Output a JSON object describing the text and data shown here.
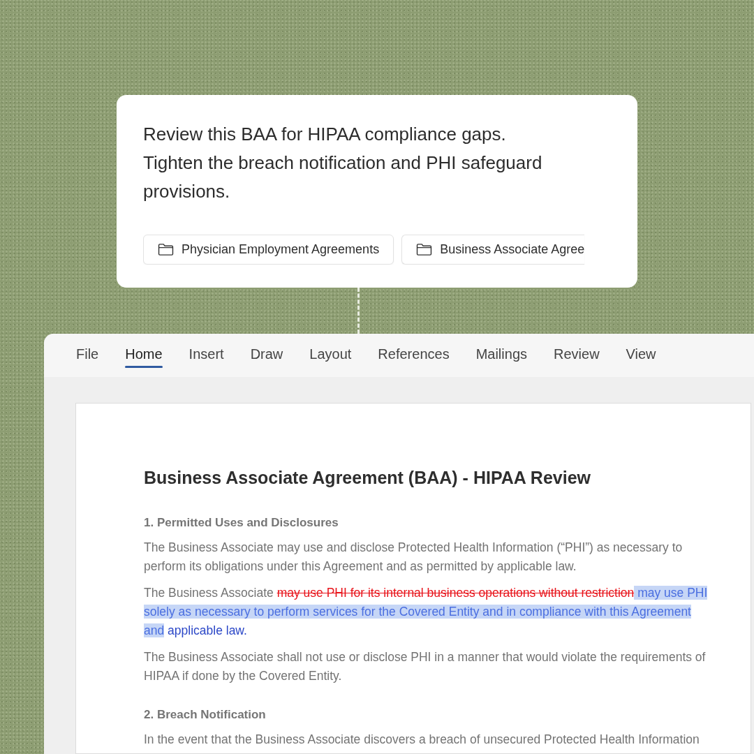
{
  "prompt": {
    "text": "Review this BAA for HIPAA compliance gaps. Tighten the breach notification and PHI safeguard provisions.",
    "folders": [
      {
        "label": "Physician Employment Agreements",
        "cut": false
      },
      {
        "label": "Business Associate Agree",
        "cut": true
      }
    ]
  },
  "ribbon": {
    "tabs": [
      {
        "label": "File",
        "selected": false
      },
      {
        "label": "Home",
        "selected": true
      },
      {
        "label": "Insert",
        "selected": false
      },
      {
        "label": "Draw",
        "selected": false
      },
      {
        "label": "Layout",
        "selected": false
      },
      {
        "label": "References",
        "selected": false
      },
      {
        "label": "Mailings",
        "selected": false
      },
      {
        "label": "Review",
        "selected": false
      },
      {
        "label": "View",
        "selected": false
      }
    ]
  },
  "document": {
    "title": "Business Associate Agreement (BAA) - HIPAA Review",
    "sections": [
      {
        "heading": "1. Permitted Uses and Disclosures",
        "paragraphs": [
          [
            {
              "kind": "plain",
              "text": "The Business Associate may use and disclose Protected Health Information (“PHI”) as necessary to perform its obligations under this Agreement and as permitted by applicable law.",
              "selected": false
            }
          ],
          [
            {
              "kind": "plain",
              "text": "The Business Associate ",
              "selected": false
            },
            {
              "kind": "deleted",
              "text": "may use PHI for its internal business operations without restriction",
              "selected": false
            },
            {
              "kind": "inserted",
              "text": " may use PHI solely as necessary to perform services for the Covered Entity and in compliance with this Agreement and",
              "selected": true
            },
            {
              "kind": "inserted",
              "text": " applicable law.",
              "selected": false
            }
          ],
          [
            {
              "kind": "plain",
              "text": "The Business Associate shall not use or disclose PHI in a manner that would violate the requirements of HIPAA if done by the Covered Entity.",
              "selected": false
            }
          ]
        ]
      },
      {
        "heading": "2. Breach Notification",
        "paragraphs": [
          [
            {
              "kind": "plain",
              "text": "In the event that the Business Associate discovers a breach of unsecured Protected Health Information",
              "selected": false
            }
          ]
        ]
      }
    ]
  }
}
